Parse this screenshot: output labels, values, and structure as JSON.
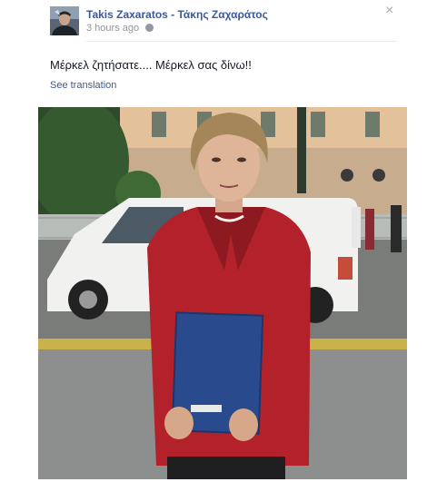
{
  "post": {
    "author": "Takis Zaxaratos - Τάκης Ζαχαράτος",
    "timestamp": "3 hours ago",
    "privacy_icon": "globe-icon",
    "close_icon": "close-icon",
    "close_glyph": "×",
    "message": "Μέρκελ ζητήσατε.... Μέρκελ σας δίνω!!",
    "translation_link": "See translation"
  },
  "colors": {
    "link": "#3b5998",
    "meta_text": "#90949c",
    "body_text": "#141823",
    "jacket": "#b3222a"
  }
}
